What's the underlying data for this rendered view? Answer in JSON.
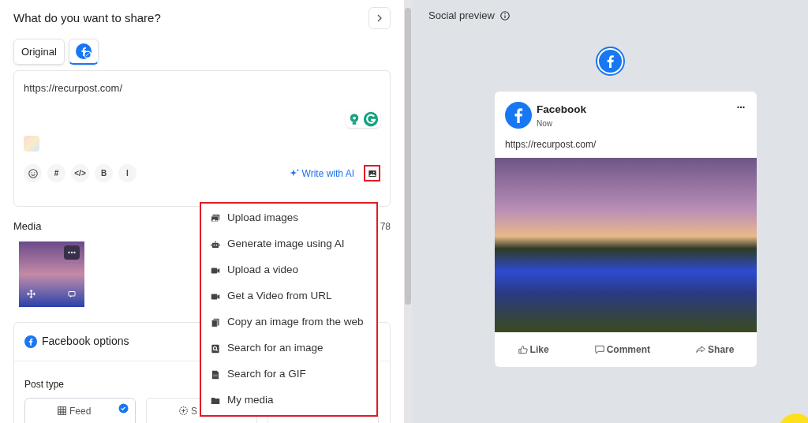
{
  "header": {
    "title": "What do you want to share?"
  },
  "tabs": [
    {
      "kind": "text",
      "label": "Original",
      "selected": false
    },
    {
      "kind": "facebook",
      "selected": true
    }
  ],
  "editor": {
    "value": "https://recurpost.com/",
    "write_ai": "Write with AI",
    "media_menu_open": true,
    "toolbar": [
      {
        "kind": "emoji"
      },
      {
        "kind": "char",
        "label": "#"
      },
      {
        "kind": "char",
        "label": "</>"
      },
      {
        "kind": "char",
        "label": "B"
      },
      {
        "kind": "char",
        "label": "I"
      }
    ]
  },
  "media": {
    "title": "Media",
    "count": "78"
  },
  "menu": {
    "items": [
      {
        "kind": "images",
        "label": "Upload images"
      },
      {
        "kind": "robot",
        "label": "Generate image using AI"
      },
      {
        "kind": "video",
        "label": "Upload a video"
      },
      {
        "kind": "video",
        "label": "Get a Video from URL"
      },
      {
        "kind": "copy",
        "label": "Copy an image from the web"
      },
      {
        "kind": "search",
        "label": "Search for an image"
      },
      {
        "kind": "gif",
        "label": "Search for a GIF"
      },
      {
        "kind": "folder",
        "label": "My media"
      }
    ]
  },
  "facebook_options": {
    "title": "Facebook options",
    "post_type_label": "Post type",
    "types": [
      {
        "kind": "grid",
        "label": "Feed",
        "selected": true
      },
      {
        "kind": "plus",
        "label": "S",
        "selected": false
      },
      {
        "kind": "blank",
        "selected": false
      }
    ]
  },
  "preview": {
    "title": "Social preview",
    "name": "Facebook",
    "time": "Now",
    "text": "https://recurpost.com/",
    "actions": [
      {
        "kind": "like",
        "label": "Like"
      },
      {
        "kind": "comment",
        "label": "Comment"
      },
      {
        "kind": "share",
        "label": "Share"
      }
    ]
  }
}
